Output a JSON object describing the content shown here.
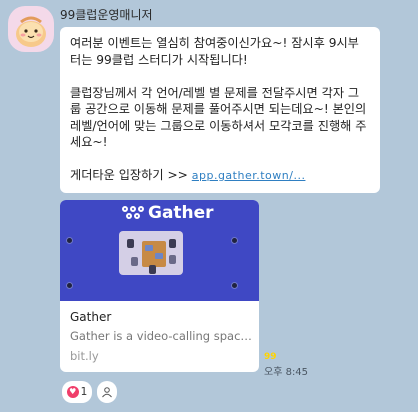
{
  "chat": {
    "sender_name": "99클럽운영매니저",
    "message": {
      "para1": "여러분 이벤트는 열심히 참여중이신가요~! 잠시후 9시부터는 99클럽 스터디가 시작됩니다!",
      "para2": "클럽장님께서 각 언어/레벨 별 문제를 전달주시면 각자 그룹 공간으로 이동해 문제를 풀어주시면 되는데요~! 본인의 레벨/언어에 맞는 그룹으로 이동하셔서 모각코를 진행해 주세요~!",
      "para3_prefix": "게더타운 입장하기 >> ",
      "link_text": "app.gather.town/..."
    },
    "preview_card": {
      "logo_text": "Gather",
      "title": "Gather",
      "description": "Gather is a video-calling space ...",
      "domain": "bit.ly"
    },
    "unread_count": "99",
    "timestamp": "오후 8:45",
    "reactions": {
      "like_count": "1"
    }
  },
  "colors": {
    "background": "#b2c7d9",
    "bubble": "#ffffff",
    "gather_blue": "#3f48c4",
    "unread": "#ffd400",
    "reaction_heart": "#f03e6a"
  },
  "icons": [
    "profile-avatar",
    "gather-logo-icon",
    "heart-icon",
    "person-icon"
  ]
}
